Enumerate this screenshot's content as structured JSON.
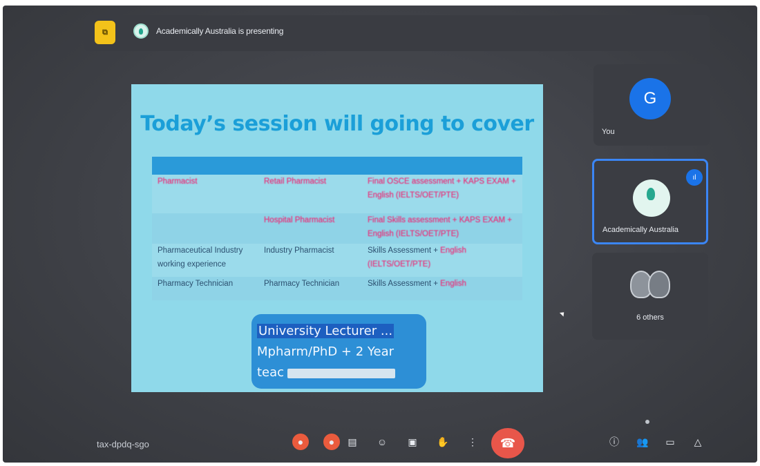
{
  "topbar": {
    "presenting_text": "Academically Australia is presenting",
    "present_icon_glyph": "⧉"
  },
  "slide": {
    "title": "Today’s session will going to cover",
    "rows": [
      {
        "c1": "Pharmacist",
        "c2": "Retail Pharmacist",
        "c3": "Final OSCE assessment + KAPS EXAM + English (IELTS/OET/PTE)"
      },
      {
        "c1": "",
        "c2": "Hospital Pharmacist",
        "c3": "Final Skills assessment + KAPS EXAM + English (IELTS/OET/PTE)"
      },
      {
        "c1": "Pharmaceutical Industry working experience",
        "c2": "Industry Pharmacist",
        "c3_a": "Skills Assessment + ",
        "c3_b": "English (IELTS/OET/PTE)"
      },
      {
        "c1": "Pharmacy Technician",
        "c2": "Pharmacy Technician",
        "c3_a": "Skills Assessment + ",
        "c3_b": "English"
      }
    ],
    "lecturer_box": {
      "line1": "University Lecturer ...",
      "line2": "Mpharm/PhD + 2 Year",
      "line3": "teac"
    }
  },
  "participants": {
    "you": {
      "initial": "G",
      "label": "You"
    },
    "presenter": {
      "label": "Academically Australia",
      "speaking_glyph": "ıl"
    },
    "others": {
      "label": "6 others"
    }
  },
  "toolbar": {
    "meeting_code": "tax-dpdq-sgo",
    "icons": [
      "mic-off-icon",
      "camera-off-icon",
      "captions-icon",
      "emoji-icon",
      "present-icon",
      "raise-hand-icon",
      "more-options-icon",
      "hang-up-icon",
      "info-icon",
      "people-icon",
      "chat-icon",
      "activities-icon"
    ]
  },
  "colors": {
    "slide_bg": "#8fd9ea",
    "title": "#1b9fd8",
    "table_header": "#2a9ad9",
    "highlight_pink": "#e7317a",
    "speaking_border": "#3b86f5",
    "hangup": "#e8564a"
  }
}
